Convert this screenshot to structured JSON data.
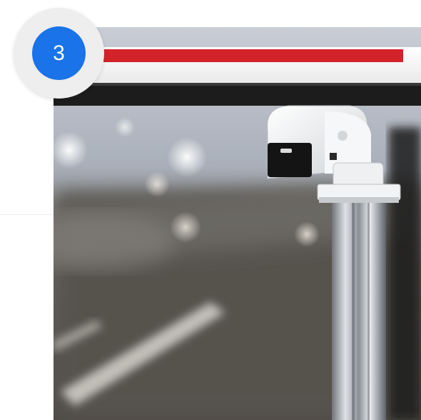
{
  "step": {
    "number": "3",
    "badge_color": "#1a73e8",
    "halo_color": "#eeeeee"
  },
  "photo": {
    "subject": "camera-on-pole-icon",
    "colors": {
      "barrier_red": "#d2232a",
      "barrier_white": "#f4f4f4",
      "barrier_dark": "#1c1c1c"
    }
  }
}
